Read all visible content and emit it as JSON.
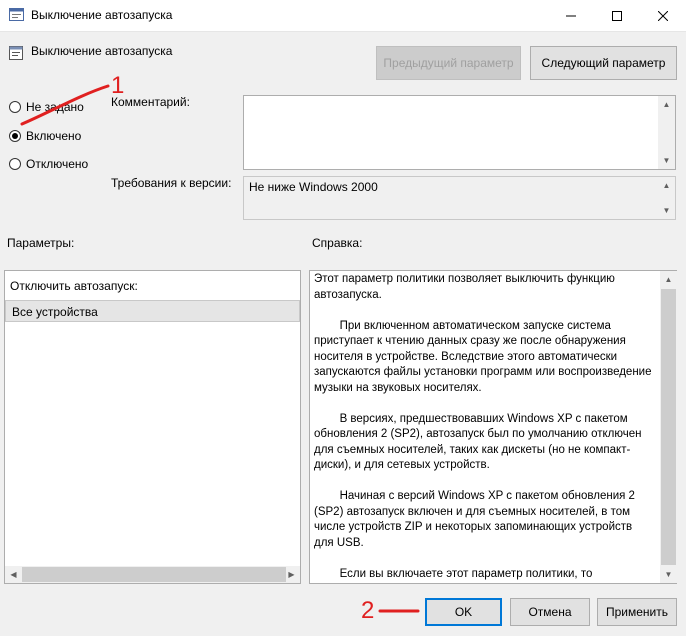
{
  "window": {
    "title": "Выключение автозапуска",
    "controls": [
      "minimize",
      "maximize",
      "close"
    ]
  },
  "header": {
    "title": "Выключение автозапуска",
    "prev_button": "Предыдущий параметр",
    "next_button": "Следующий параметр"
  },
  "state": {
    "options": [
      {
        "label": "Не задано",
        "checked": false
      },
      {
        "label": "Включено",
        "checked": true
      },
      {
        "label": "Отключено",
        "checked": false
      }
    ]
  },
  "comment": {
    "label": "Комментарий:",
    "value": ""
  },
  "requirements": {
    "label": "Требования к версии:",
    "value": "Не ниже Windows 2000"
  },
  "params": {
    "section_label": "Параметры:",
    "field_label": "Отключить автозапуск:",
    "selected_value": "Все устройства"
  },
  "help": {
    "section_label": "Справка:",
    "text": "Этот параметр политики позволяет выключить функцию автозапуска.\n\n        При включенном автоматическом запуске система приступает к чтению данных сразу же после обнаружения носителя в устройстве. Вследствие этого автоматически запускаются файлы установки программ или воспроизведение музыки на звуковых носителях.\n\n        В версиях, предшествовавших Windows XP с пакетом обновления 2 (SP2), автозапуск был по умолчанию отключен для съемных носителей, таких как дискеты (но не компакт-диски), и для сетевых устройств.\n\n        Начиная с версий Windows XP с пакетом обновления 2 (SP2) автозапуск включен и для съемных носителей, в том числе устройств ZIP и некоторых запоминающих устройств для USB.\n\n        Если вы включаете этот параметр политики, то"
  },
  "footer": {
    "ok": "OK",
    "cancel": "Отмена",
    "apply": "Применить"
  },
  "annotations": {
    "marker_1": "1",
    "marker_2": "2",
    "color": "#e02020"
  },
  "colors": {
    "accent": "#0078d7",
    "background": "#f0f0f0"
  }
}
